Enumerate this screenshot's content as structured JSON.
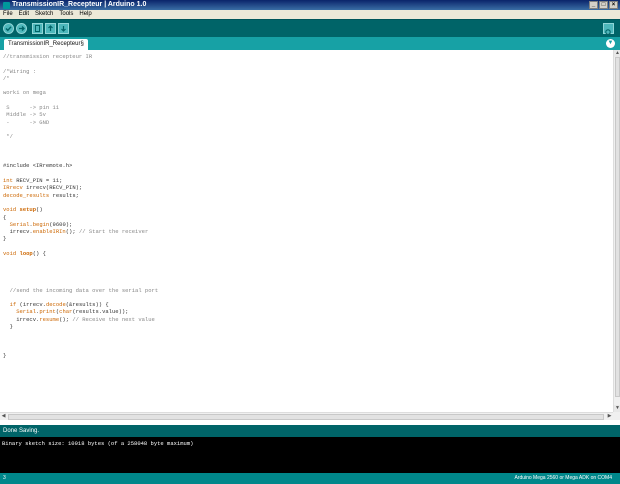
{
  "window": {
    "title": "TransmissionIR_Recepteur | Arduino 1.0",
    "controls": [
      "_",
      "□",
      "×"
    ]
  },
  "menu": {
    "items": [
      "File",
      "Edit",
      "Sketch",
      "Tools",
      "Help"
    ]
  },
  "toolbar": {
    "buttons": [
      "verify",
      "upload",
      "new",
      "open",
      "save"
    ],
    "serial_monitor": "serial-monitor"
  },
  "tabs": [
    {
      "label": "TransmissionIR_Recepteur§"
    }
  ],
  "editor": {
    "lines": [
      [
        {
          "t": "//transmission recepteur IR",
          "c": "c"
        }
      ],
      [],
      [
        {
          "t": "/*Wiring :",
          "c": "c"
        }
      ],
      [
        {
          "t": "/*",
          "c": "c"
        }
      ],
      [],
      [
        {
          "t": "worki on mega",
          "c": "c"
        }
      ],
      [],
      [
        {
          "t": " S      -> pin 11",
          "c": "c"
        }
      ],
      [
        {
          "t": " Middle -> 5v",
          "c": "c"
        }
      ],
      [
        {
          "t": " -      -> GND",
          "c": "c"
        }
      ],
      [],
      [
        {
          "t": " */",
          "c": "c"
        }
      ],
      [],
      [],
      [],
      [
        {
          "t": "#include <IRremote.h>",
          "c": ""
        }
      ],
      [],
      [
        {
          "t": "int",
          "c": "ty"
        },
        {
          "t": " RECV_PIN = 11;",
          "c": ""
        }
      ],
      [
        {
          "t": "IRrecv",
          "c": "obj"
        },
        {
          "t": " irrecv(RECV_PIN);",
          "c": ""
        }
      ],
      [
        {
          "t": "decode_results",
          "c": "obj"
        },
        {
          "t": " results;",
          "c": ""
        }
      ],
      [],
      [
        {
          "t": "void",
          "c": "ty"
        },
        {
          "t": " ",
          "c": ""
        },
        {
          "t": "setup",
          "c": "fn"
        },
        {
          "t": "()",
          "c": ""
        }
      ],
      [
        {
          "t": "{",
          "c": ""
        }
      ],
      [
        {
          "t": "  ",
          "c": ""
        },
        {
          "t": "Serial",
          "c": "obj"
        },
        {
          "t": ".",
          "c": ""
        },
        {
          "t": "begin",
          "c": "kw"
        },
        {
          "t": "(9600);",
          "c": ""
        }
      ],
      [
        {
          "t": "  irrecv.",
          "c": ""
        },
        {
          "t": "enableIRIn",
          "c": "kw"
        },
        {
          "t": "(); ",
          "c": ""
        },
        {
          "t": "// Start the receiver",
          "c": "c"
        }
      ],
      [
        {
          "t": "}",
          "c": ""
        }
      ],
      [],
      [
        {
          "t": "void",
          "c": "ty"
        },
        {
          "t": " ",
          "c": ""
        },
        {
          "t": "loop",
          "c": "fn"
        },
        {
          "t": "() {",
          "c": ""
        }
      ],
      [],
      [],
      [],
      [],
      [
        {
          "t": "  ",
          "c": ""
        },
        {
          "t": "//send the incoming data over the serial port",
          "c": "c"
        }
      ],
      [],
      [
        {
          "t": "  ",
          "c": ""
        },
        {
          "t": "if",
          "c": "kw"
        },
        {
          "t": " (irrecv.",
          "c": ""
        },
        {
          "t": "decode",
          "c": "kw"
        },
        {
          "t": "(&results)) {",
          "c": ""
        }
      ],
      [
        {
          "t": "    ",
          "c": ""
        },
        {
          "t": "Serial",
          "c": "obj"
        },
        {
          "t": ".",
          "c": ""
        },
        {
          "t": "print",
          "c": "kw"
        },
        {
          "t": "(",
          "c": ""
        },
        {
          "t": "char",
          "c": "ty"
        },
        {
          "t": "(results.value));",
          "c": ""
        }
      ],
      [
        {
          "t": "    irrecv.",
          "c": ""
        },
        {
          "t": "resume",
          "c": "kw"
        },
        {
          "t": "(); ",
          "c": ""
        },
        {
          "t": "// Receive the next value",
          "c": "c"
        }
      ],
      [
        {
          "t": "  }",
          "c": ""
        }
      ],
      [],
      [],
      [],
      [
        {
          "t": "}",
          "c": ""
        }
      ]
    ]
  },
  "status": {
    "message": "Done Saving."
  },
  "console": {
    "lines": [
      "Binary sketch size: 10018 bytes (of a 258048 byte maximum)"
    ]
  },
  "bottom": {
    "line_number": "3",
    "board": "Arduino Mega 2560 or Mega ADK on COM4"
  },
  "colors": {
    "toolbar": "#006468",
    "tabbar": "#17a1a5",
    "accent": "#4db7bb",
    "console_bg": "#000000"
  }
}
